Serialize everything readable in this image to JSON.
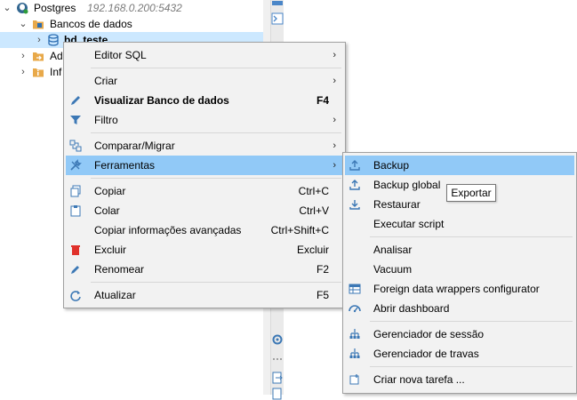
{
  "tree": {
    "connection_name": "Postgres",
    "connection_host": "192.168.0.200:5432",
    "databases_folder": "Bancos de dados",
    "selected_db": "bd_teste",
    "admin_item": "Ad",
    "info_item": "Inf"
  },
  "context_menu": {
    "items": [
      {
        "label": "Editor SQL",
        "shortcut": "",
        "submenu": true,
        "icon": "none"
      },
      {
        "label": "Criar",
        "shortcut": "",
        "submenu": true,
        "icon": "none"
      },
      {
        "label": "Visualizar Banco de dados",
        "shortcut": "F4",
        "submenu": false,
        "icon": "pencil-icon",
        "bold": true
      },
      {
        "label": "Filtro",
        "shortcut": "",
        "submenu": true,
        "icon": "filter-icon"
      },
      {
        "label": "Comparar/Migrar",
        "shortcut": "",
        "submenu": true,
        "icon": "compare-icon"
      },
      {
        "label": "Ferramentas",
        "shortcut": "",
        "submenu": true,
        "icon": "tools-icon"
      },
      {
        "label": "Copiar",
        "shortcut": "Ctrl+C",
        "submenu": false,
        "icon": "copy-icon"
      },
      {
        "label": "Colar",
        "shortcut": "Ctrl+V",
        "submenu": false,
        "icon": "paste-icon"
      },
      {
        "label": "Copiar informações avançadas",
        "shortcut": "Ctrl+Shift+C",
        "submenu": false,
        "icon": "none"
      },
      {
        "label": "Excluir",
        "shortcut": "Excluir",
        "submenu": false,
        "icon": "delete-icon"
      },
      {
        "label": "Renomear",
        "shortcut": "F2",
        "submenu": false,
        "icon": "rename-icon"
      },
      {
        "label": "Atualizar",
        "shortcut": "F5",
        "submenu": false,
        "icon": "refresh-icon"
      }
    ]
  },
  "tools_submenu": {
    "items": [
      {
        "label": "Backup",
        "icon": "backup-icon"
      },
      {
        "label": "Backup global",
        "icon": "backup-global-icon"
      },
      {
        "label": "Restaurar",
        "icon": "restore-icon"
      },
      {
        "label": "Executar script",
        "icon": "none"
      },
      {
        "label": "Analisar",
        "icon": "none"
      },
      {
        "label": "Vacuum",
        "icon": "none"
      },
      {
        "label": "Foreign data wrappers configurator",
        "icon": "table-icon"
      },
      {
        "label": "Abrir dashboard",
        "icon": "dashboard-icon"
      },
      {
        "label": "Gerenciador de sessão",
        "icon": "session-icon"
      },
      {
        "label": "Gerenciador de travas",
        "icon": "lock-manager-icon"
      },
      {
        "label": "Criar nova tarefa ...",
        "icon": "new-task-icon"
      }
    ]
  },
  "tooltip": "Exportar",
  "colors": {
    "highlight": "#91c9f7",
    "menu_bg": "#f2f2f2",
    "selection": "#cce8ff"
  }
}
